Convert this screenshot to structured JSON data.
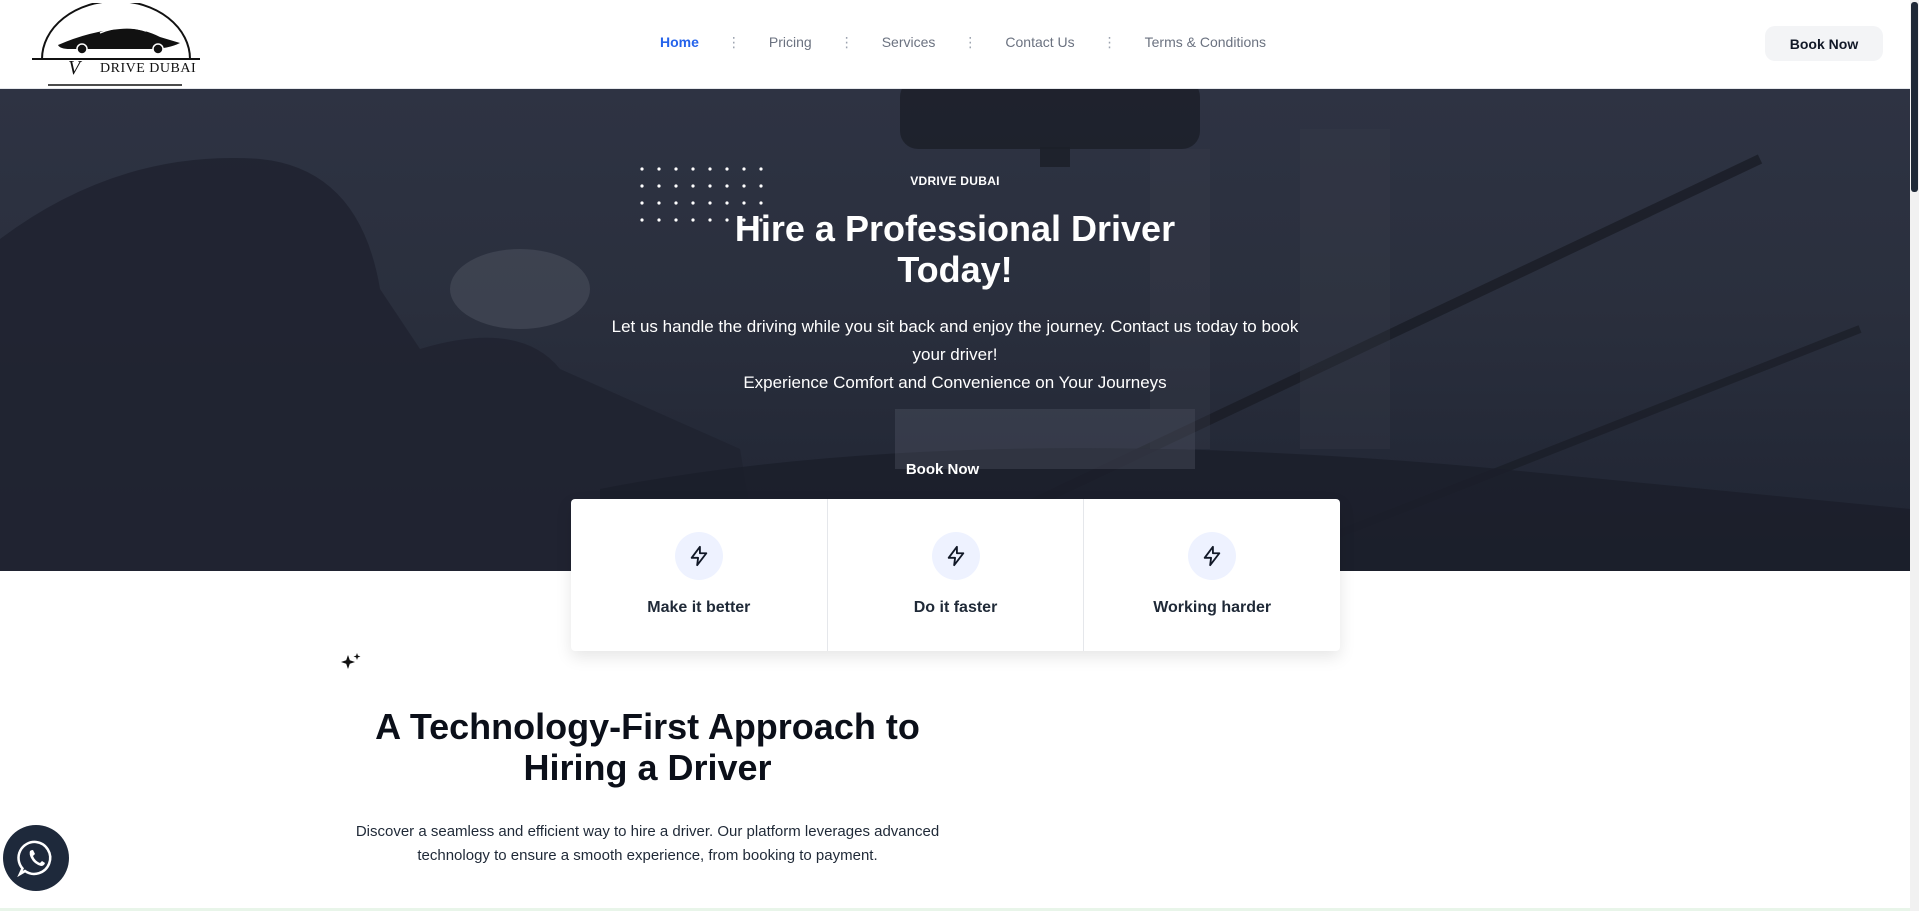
{
  "header": {
    "logo_text": "DRIVE DUBAI",
    "logo_monogram": "V",
    "nav": [
      {
        "label": "Home",
        "active": true
      },
      {
        "label": "Pricing",
        "active": false
      },
      {
        "label": "Services",
        "active": false
      },
      {
        "label": "Contact Us",
        "active": false
      },
      {
        "label": "Terms & Conditions",
        "active": false
      }
    ],
    "book_label": "Book Now"
  },
  "hero": {
    "eyebrow": "VDRIVE DUBAI",
    "title_line1": "Hire a Professional Driver",
    "title_line2": "Today!",
    "subtitle": "Let us handle the driving while you sit back and enjoy the journey. Contact us today to book your driver!",
    "subtitle2": "Experience Comfort and Convenience on Your Journeys",
    "book_label": "Book Now"
  },
  "features": [
    {
      "icon": "lightning-icon",
      "label": "Make it better"
    },
    {
      "icon": "lightning-icon",
      "label": "Do it faster"
    },
    {
      "icon": "lightning-icon",
      "label": "Working harder"
    }
  ],
  "tech": {
    "icon": "sparkle-icon",
    "title_line1": "A Technology-First Approach to",
    "title_line2": "Hiring a Driver",
    "description": "Discover a seamless and efficient way to hire a driver. Our platform leverages advanced technology to ensure a smooth experience, from booking to payment."
  },
  "colors": {
    "accent": "#2563eb",
    "hero_overlay": "#2a2f3d",
    "icon_bg": "#eef2ff"
  },
  "whatsapp": {
    "icon": "whatsapp-icon"
  }
}
